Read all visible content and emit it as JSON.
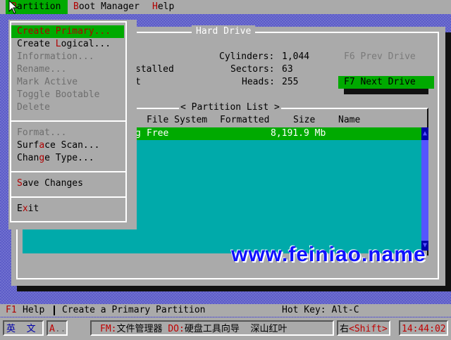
{
  "menubar": {
    "items": [
      {
        "label": "Partition",
        "pre": "",
        "hot": "P",
        "rest": "artition"
      },
      {
        "label": "Boot Manager",
        "pre": "",
        "hot": "B",
        "rest": "oot Manager"
      },
      {
        "label": "Help",
        "pre": "",
        "hot": "H",
        "rest": "elp"
      }
    ]
  },
  "hard_drive": {
    "title": "Hard Drive",
    "installed_fragment": "stalled",
    "t_fragment": "t",
    "cylinders_label": "Cylinders:",
    "cylinders_value": "1,044",
    "sectors_label": "Sectors:",
    "sectors_value": "63",
    "heads_label": "Heads:",
    "heads_value": "255",
    "prev_drive": "F6 Prev Drive",
    "next_drive": "F7 Next Drive"
  },
  "partition_list": {
    "title": "< Partition List >",
    "columns": {
      "file_system": "File System",
      "formatted": "Formatted",
      "size": "Size",
      "name": "Name"
    },
    "row": {
      "prefix": "g",
      "file_system": "Free",
      "size": "8,191.9 Mb"
    }
  },
  "partition_menu": {
    "items": [
      {
        "pre": "",
        "hot": "C",
        "rest": "reate Primary...",
        "state": "selected"
      },
      {
        "pre": "Create ",
        "hot": "L",
        "rest": "ogical...",
        "state": "enabled"
      },
      {
        "pre": "Information...",
        "hot": "",
        "rest": "",
        "state": "disabled"
      },
      {
        "pre": "Rename...",
        "hot": "",
        "rest": "",
        "state": "disabled"
      },
      {
        "pre": "Mark Active",
        "hot": "",
        "rest": "",
        "state": "disabled"
      },
      {
        "pre": "Toggle Bootable",
        "hot": "",
        "rest": "",
        "state": "disabled"
      },
      {
        "pre": "Delete",
        "hot": "",
        "rest": "",
        "state": "disabled"
      },
      {
        "pre": "Format...",
        "hot": "",
        "rest": "",
        "state": "disabled"
      },
      {
        "pre": "Surf",
        "hot": "a",
        "rest": "ce Scan...",
        "state": "enabled"
      },
      {
        "pre": "Chan",
        "hot": "g",
        "rest": "e Type...",
        "state": "enabled"
      },
      {
        "pre": "",
        "hot": "S",
        "rest": "ave Changes",
        "state": "enabled"
      },
      {
        "pre": "E",
        "hot": "x",
        "rest": "it",
        "state": "enabled"
      }
    ]
  },
  "watermark": "www.feiniao.name",
  "statusbar": {
    "f1_key": "F1",
    "f1_label": "Help",
    "message": "Create a Primary Partition",
    "hotkey": "Hot Key: Alt-C"
  },
  "taskbar": {
    "lang_en": "英",
    "lang_cn": "文",
    "a_label": "A",
    "a_dots": "..",
    "fm_key": "FM:",
    "fm_label": "文件管理器",
    "do_key": "DO:",
    "do_label": "硬盘工具向导",
    "location": "深山红叶",
    "right_char": "右",
    "shift_label": "<Shift>",
    "time": "14:44:02"
  },
  "colors": {
    "menu_bg": "#aaaaaa",
    "highlight": "#00aa00",
    "list_bg": "#00aaaa",
    "hotkey": "#b00000",
    "watermark": "#1010ff"
  }
}
